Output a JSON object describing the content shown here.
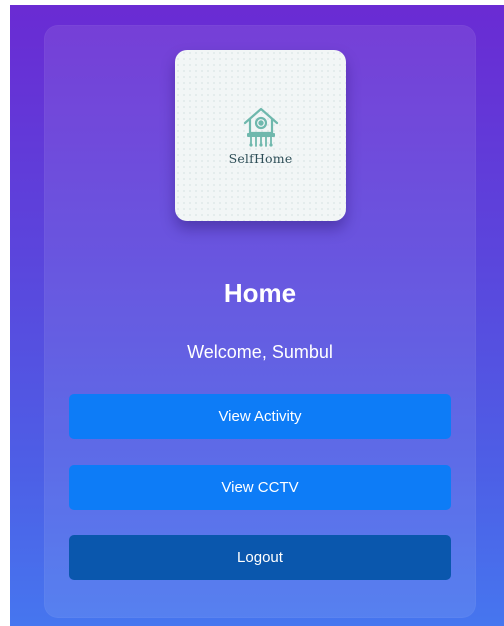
{
  "app": {
    "logo_text": "SelfHome"
  },
  "home": {
    "title": "Home",
    "welcome": "Welcome, Sumbul"
  },
  "buttons": {
    "view_activity": "View Activity",
    "view_cctv": "View CCTV",
    "logout": "Logout"
  },
  "colors": {
    "background_top": "#6a2bd3",
    "background_bottom": "#4676ef",
    "primary_button": "#0d7cf7",
    "logout_button": "#0a57ad",
    "logo_teal": "#6fb8ad"
  },
  "icons": {
    "logo": "house-circuit-icon"
  }
}
